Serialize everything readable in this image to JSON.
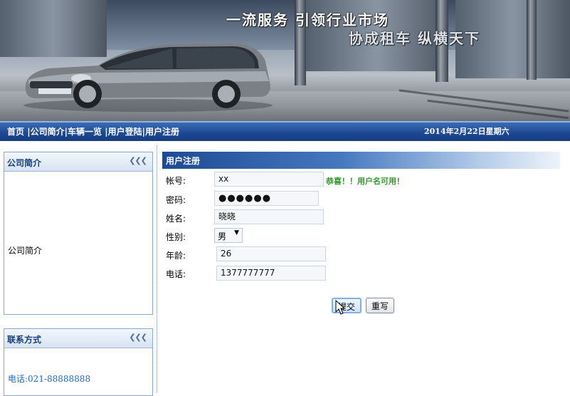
{
  "banner": {
    "slogan_line1": "一流服务 引领行业市场",
    "slogan_line2": "协成租车 纵横天下"
  },
  "nav": {
    "home": "首页",
    "company_intro": "公司简介",
    "vehicles": "车辆一览",
    "login": "用户登陆",
    "register": "用户注册",
    "sep": "|",
    "date": "2014年2月22日星期六"
  },
  "sidebar": {
    "intro": {
      "title": "公司简介",
      "body": "公司简介",
      "collapse_icon": "triple-chevron-left-icon"
    },
    "contact": {
      "title": "联系方式",
      "phone": "电话:021-88888888",
      "collapse_icon": "triple-chevron-left-icon"
    }
  },
  "form": {
    "title": "用户注册",
    "labels": {
      "account": "帐号:",
      "password": "密码:",
      "name": "姓名:",
      "gender": "性别:",
      "age": "年龄:",
      "phone": "电话:"
    },
    "values": {
      "account": "xx",
      "password": "●●●●●●",
      "name": "晓晓",
      "gender": "男",
      "age": "26",
      "phone": "1377777777"
    },
    "account_check_msg": "恭喜！！用户名可用！",
    "submit_label": "提交",
    "reset_label": "重写"
  },
  "colors": {
    "nav_blue": "#1d4a94",
    "panel_title": "#143f7c",
    "success_green": "#2c9a26",
    "contact_blue": "#1d6bc9"
  }
}
